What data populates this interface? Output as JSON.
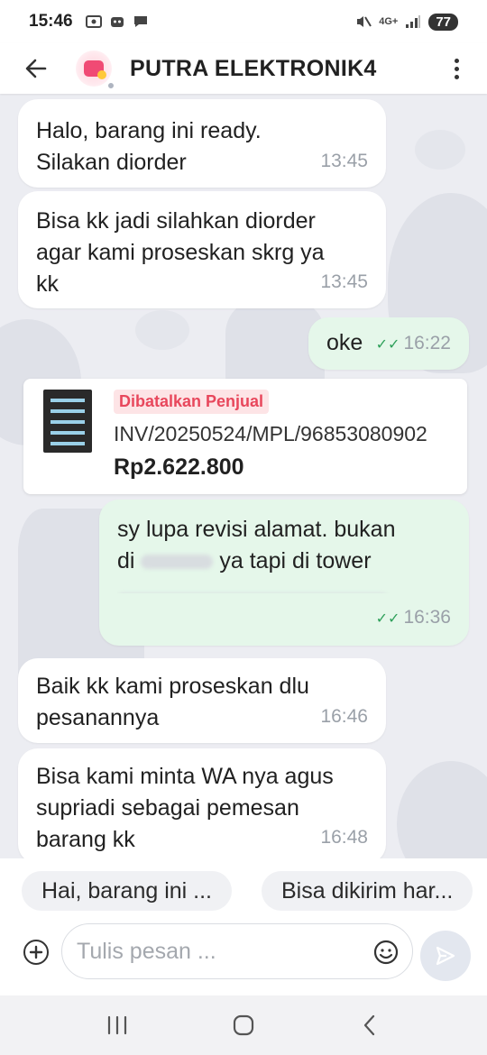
{
  "status_bar": {
    "time": "15:46",
    "network": "4G+",
    "battery": "77"
  },
  "header": {
    "shop_name": "PUTRA ELEKTRONIK4",
    "back_icon": "arrow-left-icon",
    "menu_icon": "more-vertical-icon"
  },
  "messages": [
    {
      "direction": "in",
      "text": "Halo, barang ini ready.\nSilakan diorder",
      "time": "13:45"
    },
    {
      "direction": "in",
      "text": "Bisa kk jadi silahkan diorder\nagar kami proseskan skrg ya\nkk",
      "time": "13:45"
    },
    {
      "direction": "out",
      "text": "oke",
      "time": "16:22",
      "read": true
    },
    {
      "direction": "out",
      "text_line1": "sy lupa revisi alamat. bukan",
      "text_line2_a": "di",
      "text_line2_b": "ya tapi di tower",
      "time": "16:36",
      "read": true
    },
    {
      "direction": "in",
      "text": "Baik kk kami proseskan dlu\npesanannya",
      "time": "16:46"
    },
    {
      "direction": "in",
      "text": "Bisa kami minta WA nya agus\nsupriadi sebagai pemesan\nbarang kk",
      "time": "16:48"
    }
  ],
  "product_card": {
    "status_badge": "Dibatalkan Penjual",
    "invoice": "INV/20250524/MPL/96853080902",
    "price": "Rp2.622.800",
    "badge_color": "#e8475c"
  },
  "quick_replies": [
    {
      "label": "Hai, barang ini ..."
    },
    {
      "label": "Bisa dikirim har..."
    }
  ],
  "input": {
    "placeholder": "Tulis pesan ..."
  },
  "colors": {
    "outgoing_bubble": "#e5f7ea",
    "incoming_bubble": "#ffffff",
    "read_check": "#2ea05a"
  }
}
